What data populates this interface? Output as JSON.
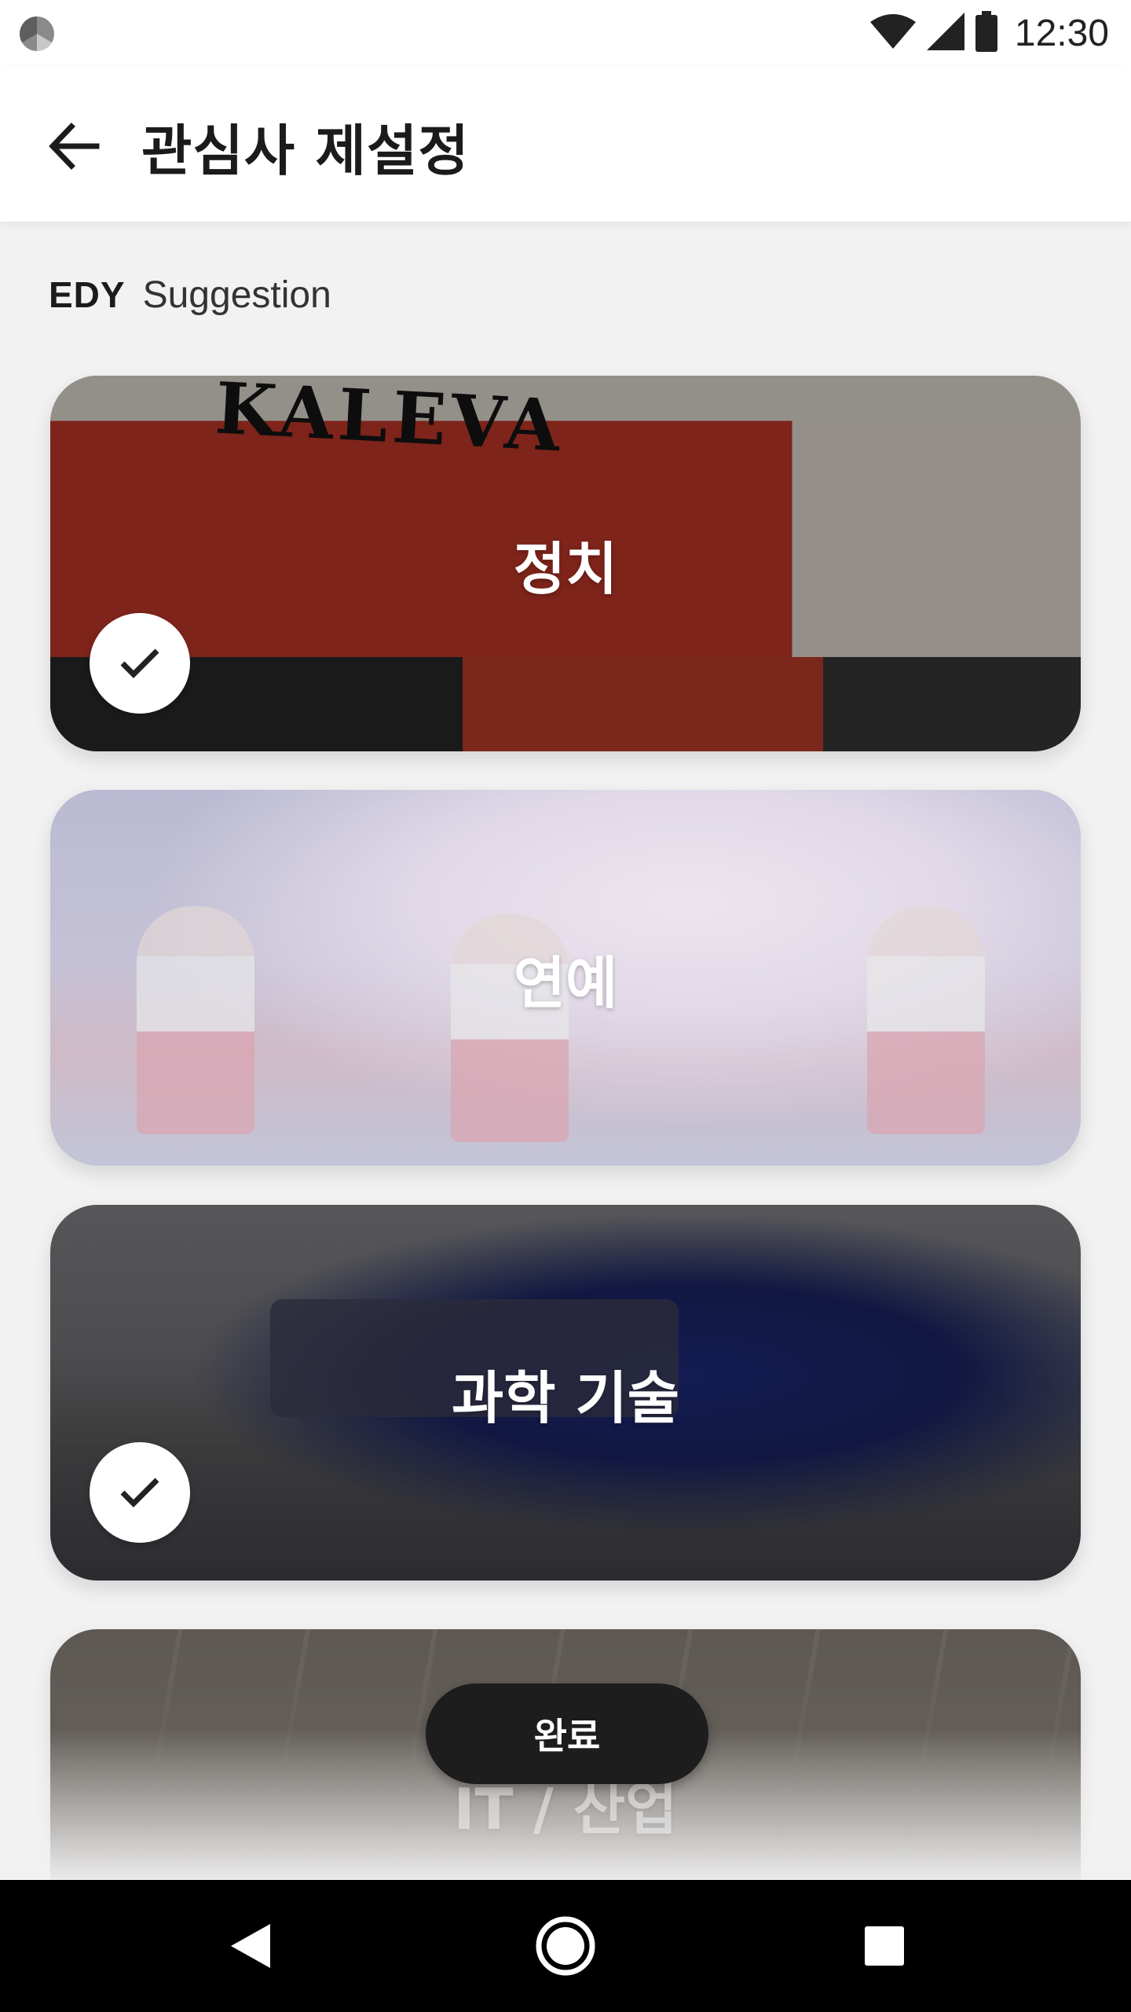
{
  "status_bar": {
    "time": "12:30",
    "icons": [
      "app-notification-icon",
      "wifi-icon",
      "cell-signal-icon",
      "battery-icon"
    ]
  },
  "header": {
    "title": "관심사 제설정",
    "back_icon": "arrow-left-icon"
  },
  "suggestion": {
    "logo": "EDY",
    "label": "Suggestion"
  },
  "topics": [
    {
      "label": "정치",
      "selected": true,
      "image": "newspaper"
    },
    {
      "label": "연예",
      "selected": false,
      "image": "stage-performers"
    },
    {
      "label": "과학 기술",
      "selected": true,
      "image": "hand-projector"
    },
    {
      "label": "IT / 산업",
      "selected": false,
      "image": "keyboard"
    }
  ],
  "newspaper_text": "KALEVA",
  "done_button": {
    "label": "완료"
  },
  "nav_bar": {
    "icons": [
      "back-triangle-icon",
      "home-circle-icon",
      "recents-square-icon"
    ]
  },
  "colors": {
    "background": "#f2f2f2",
    "title": "#1b1b1b",
    "button": "#1d1d1d",
    "nav": "#000000"
  }
}
